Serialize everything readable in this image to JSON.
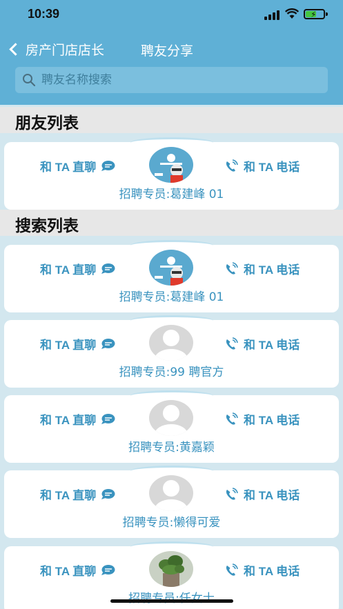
{
  "status": {
    "time": "10:39"
  },
  "nav": {
    "back_label": "房产门店店长",
    "title": "聘友分享"
  },
  "search": {
    "placeholder": "聘友名称搜索"
  },
  "sections": {
    "friends_title": "朋友列表",
    "search_title": "搜索列表"
  },
  "actions": {
    "chat_label": "和 TA 直聊",
    "call_label": "和 TA 电话"
  },
  "friends": [
    {
      "recruiter": "招聘专员:葛建峰 01",
      "avatar": "logo-avatar"
    }
  ],
  "results": [
    {
      "recruiter": "招聘专员:葛建峰 01",
      "avatar": "logo-avatar"
    },
    {
      "recruiter": "招聘专员:99 聘官方",
      "avatar": "default-avatar"
    },
    {
      "recruiter": "招聘专员:黄嘉颖",
      "avatar": "default-avatar"
    },
    {
      "recruiter": "招聘专员:懒得可爱",
      "avatar": "default-avatar"
    },
    {
      "recruiter": "招聘专员:任女士",
      "avatar": "plant-photo-avatar"
    }
  ],
  "colors": {
    "header": "#5fb0d6",
    "accent": "#3a93bf",
    "background": "#d3e7ef",
    "section": "#e7e7e7"
  }
}
